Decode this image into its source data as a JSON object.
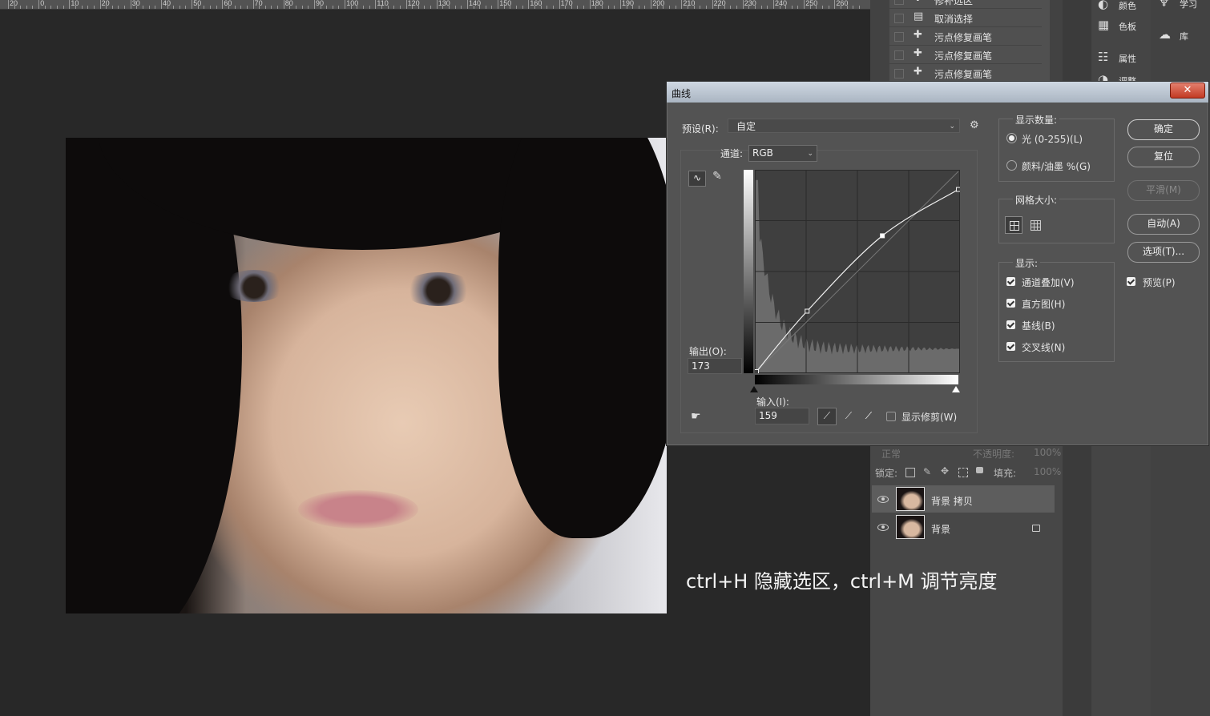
{
  "ruler": {
    "labels": [
      "20",
      "0",
      "10",
      "20",
      "30",
      "40",
      "50",
      "60",
      "70",
      "80",
      "90",
      "100",
      "110",
      "120",
      "130",
      "140",
      "150",
      "160",
      "170",
      "180",
      "190",
      "200",
      "210",
      "220",
      "230",
      "240",
      "250",
      "260"
    ]
  },
  "history": {
    "items": [
      "修补选区",
      "取消选择",
      "污点修复画笔",
      "污点修复画笔",
      "污点修复画笔"
    ]
  },
  "right_panel": {
    "col1": [
      {
        "icon": "palette-icon",
        "label": "颜色"
      },
      {
        "icon": "swatches-icon",
        "label": "色板"
      },
      {
        "icon": "properties-icon",
        "label": "属性"
      },
      {
        "icon": "adjustments-icon",
        "label": "调整"
      }
    ],
    "col2": [
      {
        "icon": "learn-icon",
        "label": "学习"
      },
      {
        "icon": "libraries-icon",
        "label": "库"
      }
    ]
  },
  "layers": {
    "blend_mode": "正常",
    "opacity_label": "不透明度:",
    "opacity_value": "100%",
    "lock_label": "锁定:",
    "fill_label": "填充:",
    "fill_value": "100%",
    "rows": [
      {
        "name": "背景 拷贝",
        "selected": true,
        "locked": false
      },
      {
        "name": "背景",
        "selected": false,
        "locked": true
      }
    ]
  },
  "curves": {
    "title": "曲线",
    "close": "✕",
    "preset_label": "预设(R):",
    "preset_value": "自定",
    "channel_label": "通道:",
    "channel_value": "RGB",
    "output_label": "输出(O):",
    "output_value": "173",
    "input_label": "输入(I):",
    "input_value": "159",
    "show_clipping_label": "显示修剪(W)",
    "display_amount_title": "显示数量:",
    "light_label": "光 (0-255)(L)",
    "pigment_label": "颜料/油墨 %(G)",
    "grid_size_title": "网格大小:",
    "show_title": "显示:",
    "show_options": [
      "通道叠加(V)",
      "直方图(H)",
      "基线(B)",
      "交叉线(N)"
    ],
    "buttons": {
      "ok": "确定",
      "reset": "复位",
      "smooth": "平滑(M)",
      "auto": "自动(A)",
      "options": "选项(T)..."
    },
    "preview_label": "预览(P)",
    "curve_points": [
      [
        0,
        0
      ],
      [
        64,
        77
      ],
      [
        159,
        173
      ],
      [
        255,
        232
      ]
    ]
  },
  "caption": "ctrl+H 隐藏选区，ctrl+M 调节亮度"
}
